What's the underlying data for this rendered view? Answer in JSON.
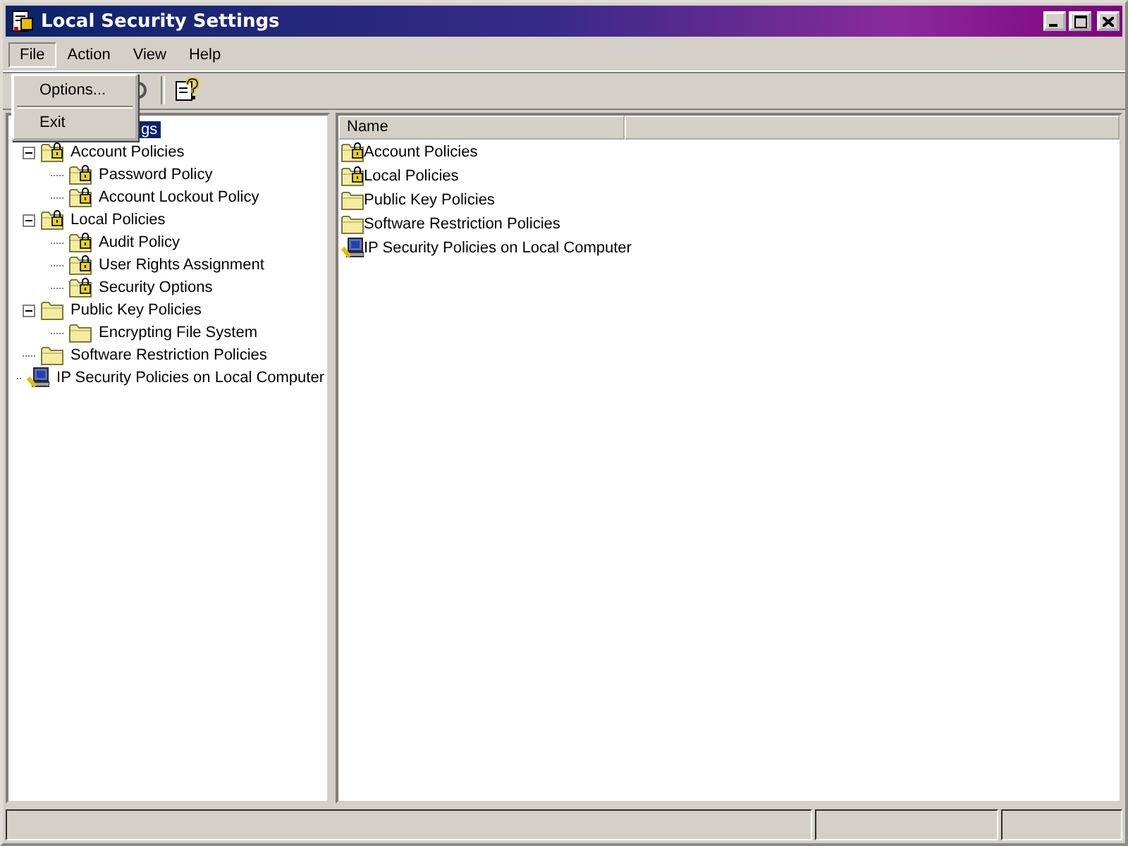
{
  "window": {
    "title": "Local Security Settings"
  },
  "menu_bar": [
    {
      "label": "File",
      "selected": true
    },
    {
      "label": "Action",
      "selected": false
    },
    {
      "label": "View",
      "selected": false
    },
    {
      "label": "Help",
      "selected": false
    }
  ],
  "open_menu": {
    "items": [
      {
        "kind": "item",
        "label": "Options..."
      },
      {
        "kind": "separator"
      },
      {
        "kind": "item",
        "label": "Exit"
      }
    ]
  },
  "tree": {
    "root": {
      "label": "gs",
      "selected": true
    },
    "items": [
      {
        "label": "Account Policies",
        "kind": "locked",
        "expanded": true,
        "children": [
          {
            "label": "Password Policy",
            "kind": "locked"
          },
          {
            "label": "Account Lockout Policy",
            "kind": "locked"
          }
        ]
      },
      {
        "label": "Local Policies",
        "kind": "locked",
        "expanded": true,
        "children": [
          {
            "label": "Audit Policy",
            "kind": "locked"
          },
          {
            "label": "User Rights Assignment",
            "kind": "locked"
          },
          {
            "label": "Security Options",
            "kind": "locked"
          }
        ]
      },
      {
        "label": "Public Key Policies",
        "kind": "folder",
        "expanded": true,
        "children": [
          {
            "label": "Encrypting File System",
            "kind": "folder"
          }
        ]
      },
      {
        "label": "Software Restriction Policies",
        "kind": "folder"
      },
      {
        "label": "IP Security Policies on Local Computer",
        "kind": "network"
      }
    ]
  },
  "list": {
    "columns": [
      "Name"
    ],
    "rows": [
      {
        "label": "Account Policies",
        "kind": "locked"
      },
      {
        "label": "Local Policies",
        "kind": "locked"
      },
      {
        "label": "Public Key Policies",
        "kind": "folder"
      },
      {
        "label": "Software Restriction Policies",
        "kind": "folder"
      },
      {
        "label": "IP Security Policies on Local Computer",
        "kind": "network"
      }
    ]
  }
}
